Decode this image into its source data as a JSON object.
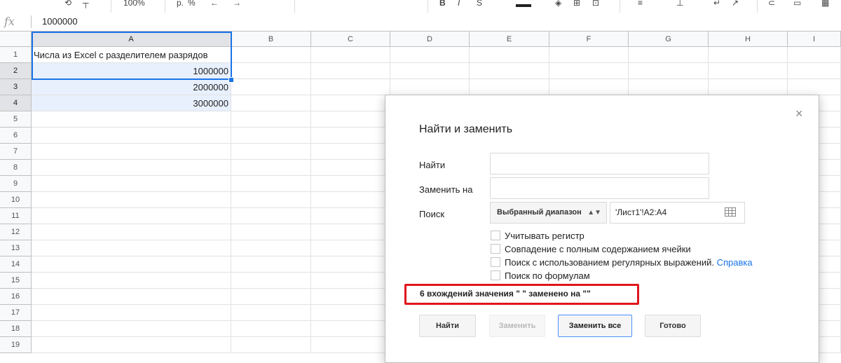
{
  "formula_bar": {
    "fx_label": "fx",
    "value": "1000000"
  },
  "columns": [
    "A",
    "B",
    "C",
    "D",
    "E",
    "F",
    "G",
    "H",
    "I"
  ],
  "rows": [
    "1",
    "2",
    "3",
    "4",
    "5",
    "6",
    "7",
    "8",
    "9",
    "10",
    "11",
    "12",
    "13",
    "14",
    "15",
    "16",
    "17",
    "18",
    "19"
  ],
  "cells": {
    "A1": "Числа из Excel с разделителем разрядов",
    "A2": "1000000",
    "A3": "2000000",
    "A4": "3000000"
  },
  "toolbar": {
    "zoom": "100%",
    "currency": "р.",
    "percent": "%"
  },
  "dialog": {
    "title": "Найти и заменить",
    "close_icon": "×",
    "find_label": "Найти",
    "find_value": "",
    "replace_label": "Заменить на",
    "replace_value": "",
    "search_label": "Поиск",
    "search_scope": "Выбранный диапазон",
    "range_value": "'Лист1'!A2:A4",
    "options": [
      {
        "label": "Учитывать регистр",
        "checked": false
      },
      {
        "label": "Совпадение с полным содержанием ячейки",
        "checked": false
      },
      {
        "label": "Поиск с использованием регулярных выражений.",
        "checked": false,
        "link": "Справка"
      },
      {
        "label": "Поиск по формулам",
        "checked": false
      }
    ],
    "result_message": "6 вхождений значения \" \" заменено на \"\"",
    "buttons": {
      "find": "Найти",
      "replace": "Заменить",
      "replace_all": "Заменить все",
      "done": "Готово"
    }
  },
  "colors": {
    "accent": "#1a73e8",
    "highlight": "#e0161c",
    "selection_fill": "#e8f0fe"
  }
}
